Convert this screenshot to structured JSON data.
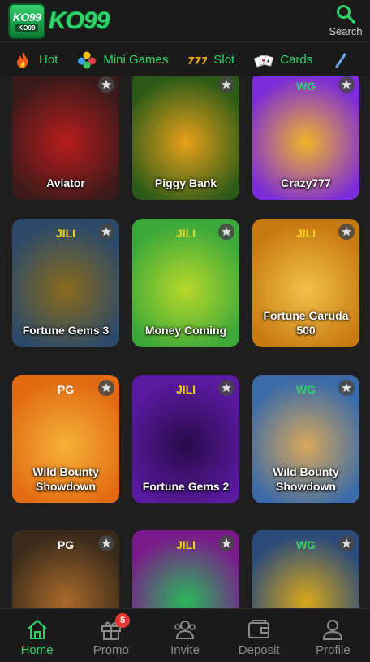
{
  "header": {
    "logo_badge_top": "KO99",
    "logo_badge_bottom": "KO99",
    "logo_text": "KO99",
    "search_label": "Search"
  },
  "tabs": [
    {
      "label": "Hot",
      "icon": "flame-icon"
    },
    {
      "label": "Mini Games",
      "icon": "balls-icon"
    },
    {
      "label": "Slot",
      "icon": "slot-777-icon"
    },
    {
      "label": "Cards",
      "icon": "cards-icon"
    }
  ],
  "games": [
    {
      "title": "Aviator",
      "brand": "",
      "colors": [
        "#3a1a1a",
        "#b81c1c"
      ]
    },
    {
      "title": "Piggy Bank",
      "brand": "",
      "colors": [
        "#2b5a18",
        "#e8a11a"
      ]
    },
    {
      "title": "Crazy777",
      "brand": "WG",
      "colors": [
        "#7b2bd8",
        "#f0b52a"
      ]
    },
    {
      "title": "Fortune Gems 3",
      "brand": "JILI",
      "colors": [
        "#2b4a6a",
        "#8a6a1a"
      ]
    },
    {
      "title": "Money Coming",
      "brand": "JILI",
      "colors": [
        "#3aa83a",
        "#b8d82a"
      ]
    },
    {
      "title": "Fortune Garuda 500",
      "brand": "JILI",
      "colors": [
        "#c87a12",
        "#f1c14a"
      ]
    },
    {
      "title": "Wild Bounty Showdown",
      "brand": "PG",
      "colors": [
        "#e26a12",
        "#f6b23a"
      ]
    },
    {
      "title": "Fortune Gems 2",
      "brand": "JILI",
      "colors": [
        "#5a1aa0",
        "#2a0a4a"
      ]
    },
    {
      "title": "Wild Bounty Showdown",
      "brand": "WG",
      "colors": [
        "#3a6aa8",
        "#d8a85a"
      ]
    },
    {
      "title": "",
      "brand": "PG",
      "colors": [
        "#3a2a1a",
        "#a86a2a"
      ]
    },
    {
      "title": "",
      "brand": "JILI",
      "colors": [
        "#7a1a8a",
        "#2ab85a"
      ]
    },
    {
      "title": "",
      "brand": "WG",
      "colors": [
        "#2a4a7a",
        "#d8a81a"
      ]
    }
  ],
  "nav": [
    {
      "label": "Home",
      "icon": "home-icon",
      "active": true
    },
    {
      "label": "Promo",
      "icon": "gift-icon",
      "badge": "5"
    },
    {
      "label": "Invite",
      "icon": "invite-icon"
    },
    {
      "label": "Deposit",
      "icon": "wallet-icon"
    },
    {
      "label": "Profile",
      "icon": "profile-icon"
    }
  ],
  "colors": {
    "accent": "#2fd36a",
    "background": "#1e1e1e",
    "bar": "#1a1a1a",
    "inactive": "#8a8a8a",
    "badge": "#e53935"
  }
}
